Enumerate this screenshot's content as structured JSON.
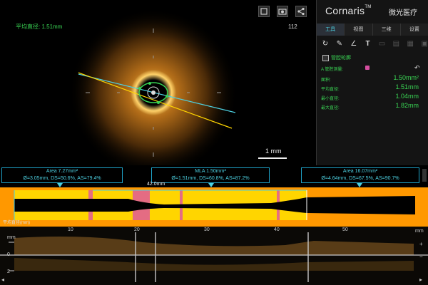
{
  "viewer": {
    "avg_diameter_label": "平均直径: 1.51mm",
    "frame_number": "112",
    "scale_label": "1 mm",
    "toolbar": [
      "expand-icon",
      "camera-icon",
      "share-icon"
    ]
  },
  "brand": {
    "name": "Cornaris",
    "tm": "TM",
    "cn": "微光医疗"
  },
  "tabs": [
    {
      "label": "工具",
      "active": true
    },
    {
      "label": "视图",
      "active": false
    },
    {
      "label": "三维",
      "active": false
    },
    {
      "label": "设置",
      "active": false
    }
  ],
  "tools": [
    "rotate-icon",
    "pen-icon",
    "angle-icon",
    "text-icon",
    "measure-icon",
    "delete-icon",
    "copy-icon",
    "export-icon"
  ],
  "lumen_contour_label": "管腔轮廓",
  "measurement_header": "A 管腔测量:",
  "measurements": [
    {
      "label": "面积:",
      "value": "1.50mm²"
    },
    {
      "label": "平均直径:",
      "value": "1.51mm"
    },
    {
      "label": "最小直径:",
      "value": "1.04mm"
    },
    {
      "label": "最大直径:",
      "value": "1.82mm"
    }
  ],
  "annotations": {
    "left": {
      "line1": "Area 7.27mm²",
      "line2": "Ø=3.05mm, DS=50.6%, AS=79.4%"
    },
    "middle": {
      "line1": "MLA 1.50mm²",
      "line2": "Ø=1.51mm, DS=60.8%, AS=87.2%"
    },
    "right": {
      "line1": "Area 16.07mm²",
      "line2": "Ø=4.64mm, DS=67.5%, AS=90.7%"
    },
    "length": "42.0mm"
  },
  "profile_label": "平均直径(mm)",
  "ruler": {
    "ticks": [
      "10",
      "20",
      "30",
      "40",
      "50"
    ],
    "unit": "mm"
  },
  "y_axis": [
    "mm",
    "0",
    "2"
  ],
  "colors": {
    "accent_cyan": "#4dd0e1",
    "measure_green": "#39d353",
    "profile_orange": "#ff9800",
    "profile_yellow": "#ffd500",
    "highlight_pink": "#e05a9a"
  }
}
